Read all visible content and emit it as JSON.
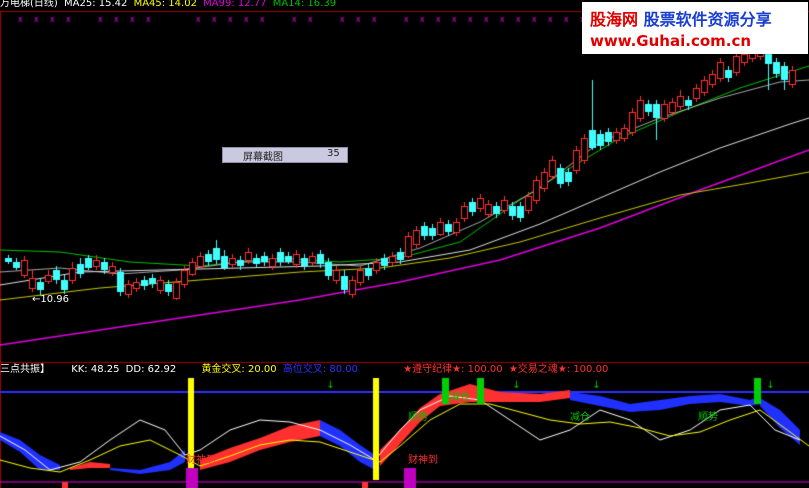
{
  "upper_header": {
    "title": "万电梯(日线)",
    "ma25": "MA25: 15.42",
    "ma45": "MA45: 14.02",
    "ma99": "MA99: 12.77",
    "ma14": "MA14: 16.39"
  },
  "watermark": {
    "brand_red": "股海网",
    "brand_blue": "股票软件资源分享",
    "url": "www.Guhai.com.cn"
  },
  "screenshot_box": {
    "label": "屏幕截图",
    "value": "35"
  },
  "low_marker": "←10.96",
  "lower_header": {
    "title": "三点共振】",
    "kk": "KK: 48.25",
    "dd": "DD: 62.92",
    "gold_cross": "黄金交叉: 20.00",
    "high_cross": "高位交叉: 80.00",
    "discipline": "★遵守纪律★: 100.00",
    "trade_soul": "★交易之魂★: 100.00"
  },
  "annotations": {
    "caishen1": "财神到",
    "caishen2": "财神到",
    "label_a": "顺势",
    "label_b": "减仓",
    "label_c": "减仓",
    "label_d": "顺势"
  },
  "colors": {
    "ma25": "#ffffff",
    "ma45": "#00c000",
    "ma99": "#e000e0",
    "ma14": "#00c0c0",
    "up": "#ff3030",
    "down": "#40ffff",
    "kk": "#ffff00",
    "dd": "#ffffff",
    "level": "#3030ff"
  }
}
